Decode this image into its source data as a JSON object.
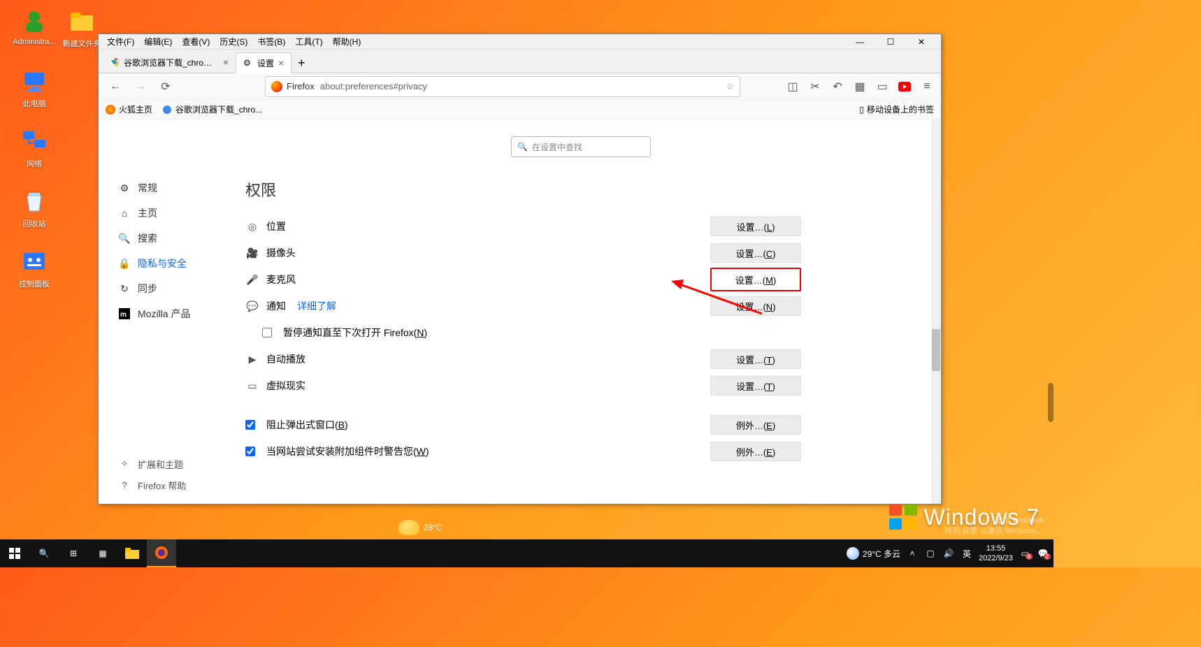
{
  "desktop": {
    "icons": [
      {
        "label": "Administra..."
      },
      {
        "label": "新建文件夹"
      },
      {
        "label": "此电脑"
      },
      {
        "label": "网络"
      },
      {
        "label": "回收站"
      },
      {
        "label": "控制面板"
      }
    ]
  },
  "window": {
    "menubar": [
      "文件(F)",
      "编辑(E)",
      "查看(V)",
      "历史(S)",
      "书签(B)",
      "工具(T)",
      "帮助(H)"
    ],
    "tabs": [
      {
        "title": "谷歌浏览器下载_chrome浏览器"
      },
      {
        "title": "设置"
      }
    ],
    "address": {
      "brand": "Firefox",
      "url": "about:preferences#privacy"
    },
    "bookmarks": {
      "items": [
        {
          "label": "火狐主页"
        },
        {
          "label": "谷歌浏览器下载_chro..."
        }
      ],
      "mobile": "移动设备上的书签"
    },
    "sidebar": {
      "items": [
        {
          "label": "常规"
        },
        {
          "label": "主页"
        },
        {
          "label": "搜索"
        },
        {
          "label": "隐私与安全"
        },
        {
          "label": "同步"
        },
        {
          "label": "Mozilla 产品"
        }
      ],
      "footer": [
        {
          "label": "扩展和主题"
        },
        {
          "label": "Firefox 帮助"
        }
      ]
    },
    "settings_search_placeholder": "在设置中查找",
    "section_title": "权限",
    "permissions": {
      "location": {
        "label": "位置",
        "btn": "设置…(L)"
      },
      "camera": {
        "label": "摄像头",
        "btn": "设置…(C)"
      },
      "mic": {
        "label": "麦克风",
        "btn": "设置…(M)"
      },
      "notif": {
        "label": "通知",
        "link": "详细了解",
        "btn": "设置…(N)"
      },
      "pause": {
        "label": "暂停通知直至下次打开 Firefox(N)"
      },
      "autoplay": {
        "label": "自动播放",
        "btn": "设置…(T)"
      },
      "vr": {
        "label": "虚拟现实",
        "btn": "设置…(T)"
      },
      "popup": {
        "label": "阻止弹出式窗口(B)",
        "btn": "例外…(E)"
      },
      "addon": {
        "label": "当网站尝试安装附加组件时警告您(W)",
        "btn": "例外…(E)"
      }
    }
  },
  "watermark": {
    "text": "Windows 7",
    "activate1": "激活 Windows",
    "activate2": "转到 设置 以激活 Windows。"
  },
  "taskbar": {
    "weather": "29°C 多云",
    "ime": "英",
    "time": "13:55",
    "date": "2022/9/23",
    "notif_count": "2",
    "action_count": "9"
  },
  "desk_weather": "28°C"
}
